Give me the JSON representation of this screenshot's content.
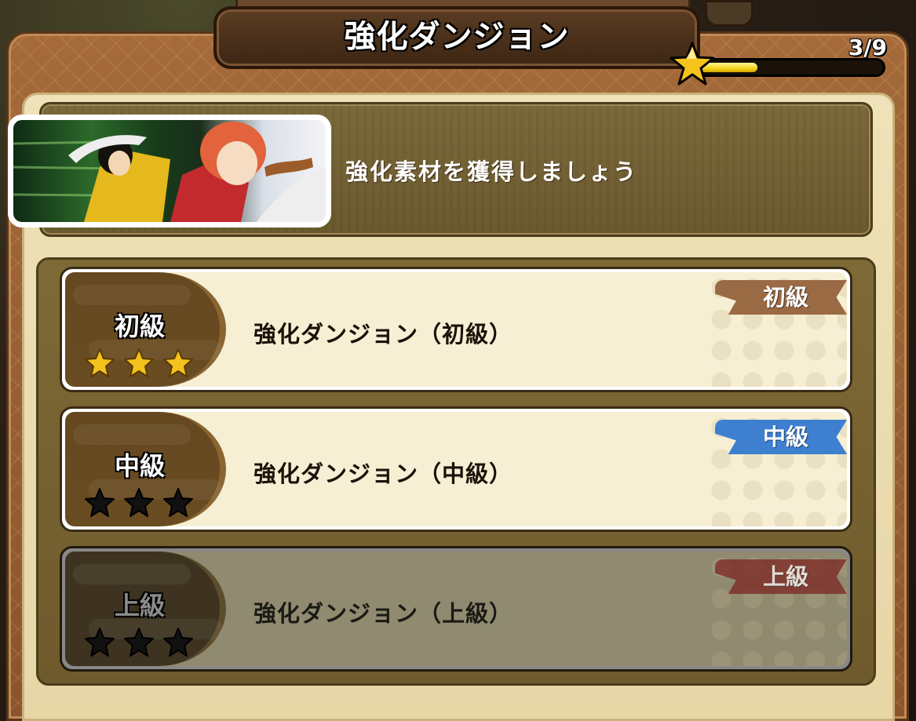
{
  "header": {
    "title": "強化ダンジョン"
  },
  "progress": {
    "count_text": "3/9",
    "fraction": 0.333,
    "star_icon": "star-icon"
  },
  "intro": {
    "text": "強化素材を獲得しましょう",
    "image": "character-art"
  },
  "colors": {
    "beginner_ribbon": "#9a6a44",
    "intermediate_ribbon": "#3e7fd0",
    "advanced_ribbon": "#7a1e1c",
    "star_gold": "#f3c21c",
    "star_empty": "#111111"
  },
  "dungeons": [
    {
      "level": "初級",
      "title": "強化ダンジョン（初級）",
      "badge": "初級",
      "stars_earned": 3,
      "stars_total": 3,
      "locked": false
    },
    {
      "level": "中級",
      "title": "強化ダンジョン（中級）",
      "badge": "中級",
      "stars_earned": 0,
      "stars_total": 3,
      "locked": false
    },
    {
      "level": "上級",
      "title": "強化ダンジョン（上級）",
      "badge": "上級",
      "stars_earned": 0,
      "stars_total": 3,
      "locked": true
    }
  ]
}
